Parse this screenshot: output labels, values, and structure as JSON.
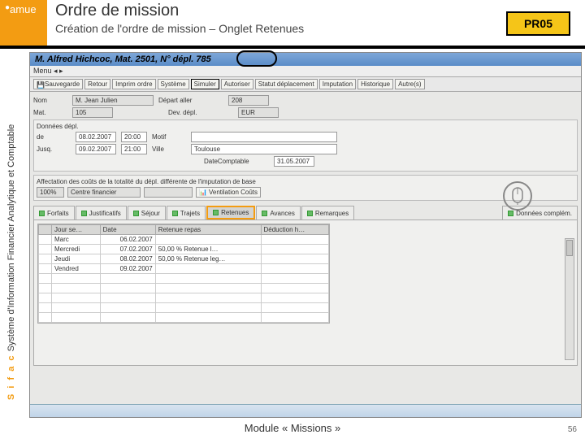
{
  "header": {
    "logo": "amue",
    "title": "Ordre de mission",
    "subtitle": "Création de l'ordre de mission – Onglet Retenues",
    "badge": "PR05"
  },
  "sidebar": {
    "acc": "S i f a c",
    "rest": " Système d'Information Financier Analytique et Comptable"
  },
  "app": {
    "window_title": "M. Alfred Hichcoc, Mat. 2501, N° dépl. 785",
    "menu": "Menu",
    "toolbar": {
      "save": "Sauvegarde",
      "back": "Retour",
      "print": "Imprim ordre",
      "system": "Système",
      "simulate": "Simuler",
      "authorize": "Autoriser",
      "status": "Statut déplacement",
      "imput": "Imputation",
      "hist": "Historique",
      "other": "Autre(s)"
    },
    "form": {
      "nom_lbl": "Nom",
      "nom_val": "M. Jean Julien",
      "depart_lbl": "Départ aller",
      "depart_val": "208",
      "mat_lbl": "Mat.",
      "mat_val": "105",
      "dev_lbl": "Dev. dépl.",
      "dev_val": "EUR",
      "dep_header": "Données dépl.",
      "de_lbl": "de",
      "de_d": "08.02.2007",
      "de_h": "20:00",
      "motif_lbl": "Motif",
      "motif_val": "",
      "jusq_lbl": "Jusq.",
      "jusq_d": "09.02.2007",
      "jusq_h": "21:00",
      "ville_lbl": "Ville",
      "ville_val": "Toulouse",
      "date_cpt_lbl": "DateComptable",
      "date_cpt_val": "31.05.2007"
    },
    "affect": {
      "title": "Affectation des coûts de la totalité du dépl. différente de l'imputation de base",
      "pct": "100%",
      "cf_lbl": "Centre financier",
      "btn": "Ventilation Coûts"
    },
    "tabs": {
      "forfaits": "Forfaits",
      "justif": "Justificatifs",
      "sejour": "Séjour",
      "trajets": "Trajets",
      "retenues": "Retenues",
      "avances": "Avances",
      "remarques": "Remarques",
      "compl": "Données complém."
    },
    "grid": {
      "cols": {
        "c1": "Jour se…",
        "c2": "Date",
        "c3": "Retenue repas",
        "c4": "Déduction h…"
      },
      "rows": [
        {
          "day": "Marc",
          "date": "06.02.2007",
          "ret": "",
          "ded": ""
        },
        {
          "day": "Mercredi",
          "date": "07.02.2007",
          "ret": "50,00 % Retenue l…",
          "ded": ""
        },
        {
          "day": "Jeudi",
          "date": "08.02.2007",
          "ret": "50,00 % Retenue leg…",
          "ded": ""
        },
        {
          "day": "Vendred",
          "date": "09.02.2007",
          "ret": "",
          "ded": ""
        }
      ]
    }
  },
  "footer": {
    "module": "Module « Missions »",
    "page": "56"
  }
}
